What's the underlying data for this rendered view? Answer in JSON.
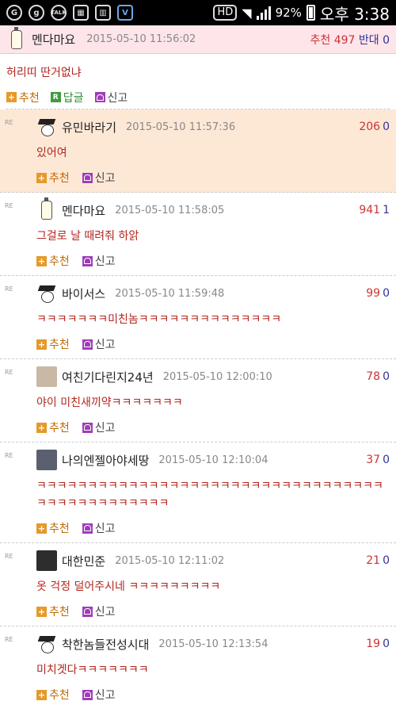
{
  "status": {
    "hd": "HD",
    "battery": "92%",
    "time": "오후 3:38",
    "icons": [
      "g-icon",
      "circle-g-icon",
      "talk-icon",
      "image-icon",
      "bar-chart-icon",
      "v-icon",
      "wifi-icon",
      "signal-icon",
      "battery-icon"
    ]
  },
  "post": {
    "author": "멘다마요",
    "date": "2015-05-10 11:56:02",
    "recommend_label": "추천 497",
    "oppose_label": "반대 0",
    "text": "허리띠 딴거없냐",
    "actions": {
      "recommend": "추천",
      "reply": "답글",
      "report": "신고"
    }
  },
  "comments": [
    {
      "author": "유민바라기",
      "date": "2015-05-10 11:57:36",
      "up": "206",
      "down": "0",
      "text": "있어여",
      "avatar": "mortarboard"
    },
    {
      "author": "멘다마요",
      "date": "2015-05-10 11:58:05",
      "up": "941",
      "down": "1",
      "text": "그걸로 날 때려줘 하앍",
      "avatar": "bottle"
    },
    {
      "author": "바이서스",
      "date": "2015-05-10 11:59:48",
      "up": "99",
      "down": "0",
      "text": "ㅋㅋㅋㅋㅋㅋㅋ미친놈ㅋㅋㅋㅋㅋㅋㅋㅋㅋㅋㅋㅋㅋㅋ",
      "avatar": "mortarboard"
    },
    {
      "author": "여친기다린지24년",
      "date": "2015-05-10 12:00:10",
      "up": "78",
      "down": "0",
      "text": "야이 미친새끼약ㅋㅋㅋㅋㅋㅋㅋ",
      "avatar": "photo"
    },
    {
      "author": "나의엔젤아야세땅",
      "date": "2015-05-10 12:10:04",
      "up": "37",
      "down": "0",
      "text": "ㅋㅋㅋㅋㅋㅋㅋㅋㅋㅋㅋㅋㅋㅋㅋㅋㅋㅋㅋㅋㅋㅋㅋㅋㅋㅋㅋㅋㅋㅋㅋㅋㅋㅋㅋㅋㅋㅋㅋㅋㅋㅋㅋㅋㅋㅋㅋ",
      "avatar": "photo"
    },
    {
      "author": "대한민준",
      "date": "2015-05-10 12:11:02",
      "up": "21",
      "down": "0",
      "text": "옷 걱정 덜어주시네 ㅋㅋㅋㅋㅋㅋㅋㅋㅋ",
      "avatar": "photo"
    },
    {
      "author": "착한놈들전성시대",
      "date": "2015-05-10 12:13:54",
      "up": "19",
      "down": "0",
      "text": "미치겟다ㅋㅋㅋㅋㅋㅋㅋ",
      "avatar": "mortarboard"
    }
  ],
  "comment_actions": {
    "recommend": "추천",
    "report": "신고"
  },
  "re_label": "RE",
  "colors": {
    "post_bg": "#fde5ea",
    "highlight_bg": "#fde8d6",
    "text_red": "#b3261e"
  }
}
